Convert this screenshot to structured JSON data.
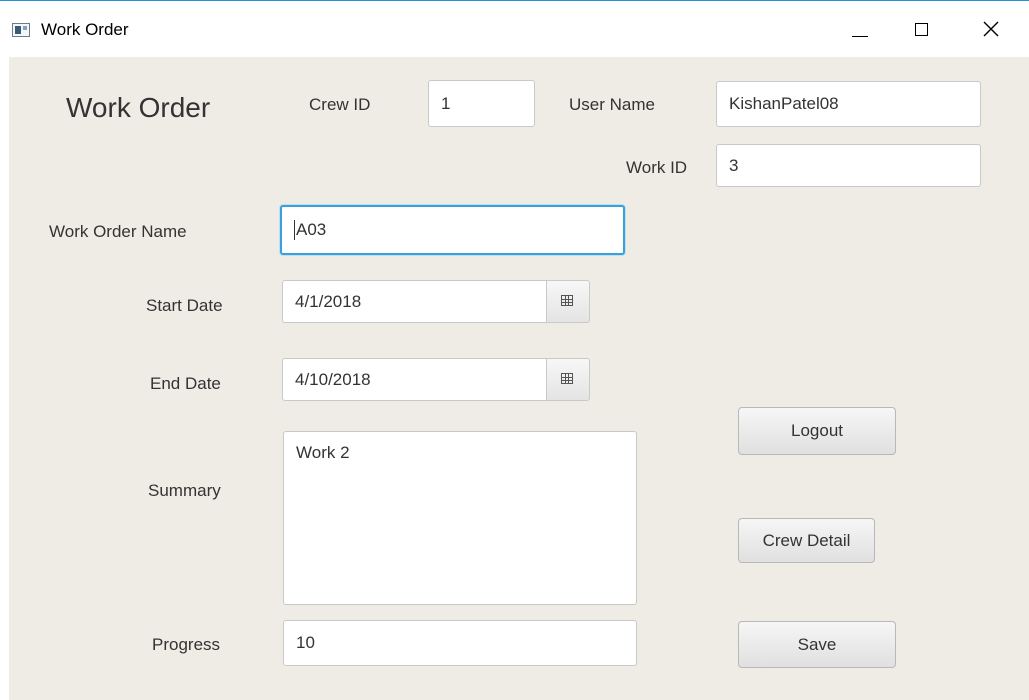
{
  "window": {
    "title": "Work Order"
  },
  "form": {
    "heading": "Work Order",
    "crew_id_label": "Crew ID",
    "crew_id_value": "1",
    "user_name_label": "User Name",
    "user_name_value": "KishanPatel08",
    "work_id_label": "Work ID",
    "work_id_value": "3",
    "work_order_name_label": "Work Order Name",
    "work_order_name_value": "A03",
    "start_date_label": "Start Date",
    "start_date_value": "4/1/2018",
    "end_date_label": "End Date",
    "end_date_value": "4/10/2018",
    "summary_label": "Summary",
    "summary_value": "Work 2",
    "progress_label": "Progress",
    "progress_value": "10"
  },
  "buttons": {
    "logout": "Logout",
    "crew_detail": "Crew Detail",
    "save": "Save"
  },
  "icons": {
    "app": "app-window-icon",
    "minimize": "minimize-icon",
    "maximize": "maximize-icon",
    "close": "close-icon",
    "calendar": "calendar-icon"
  },
  "colors": {
    "background": "#efece6",
    "focus_border": "#3aa0d8",
    "text": "#333333"
  }
}
